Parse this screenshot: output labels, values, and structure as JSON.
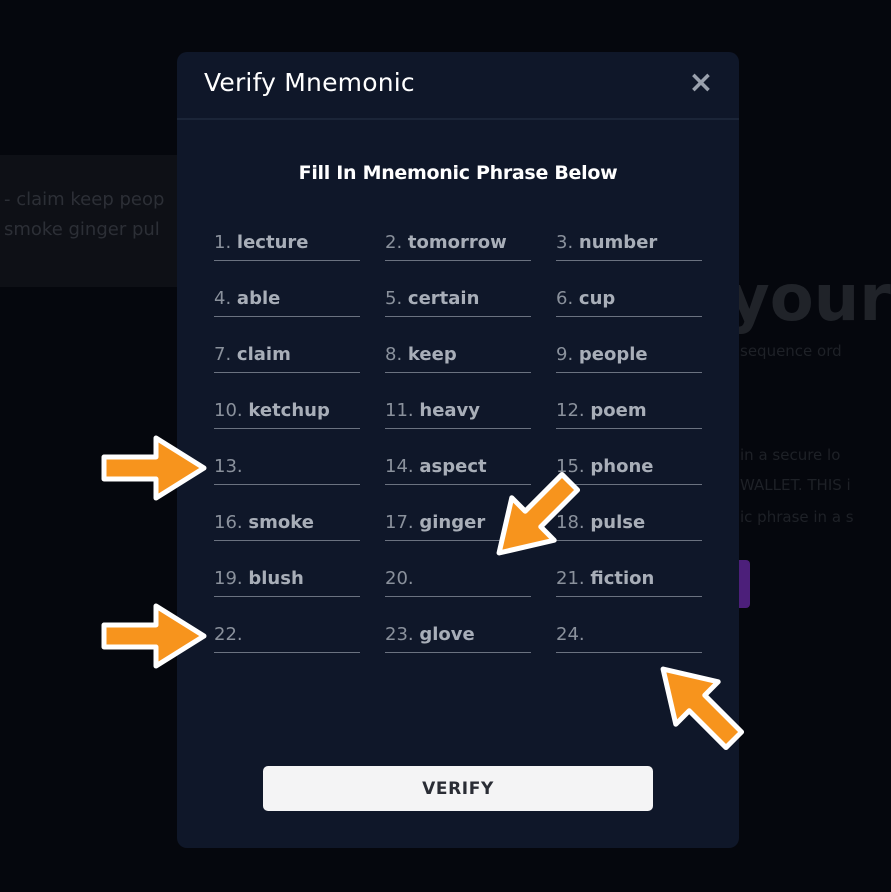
{
  "background": {
    "text_line_1": "- claim keep peop",
    "text_line_2": "smoke ginger pul",
    "heading": "your",
    "subtext_1": "sequence ord",
    "subtext_2": "in a secure lo",
    "subtext_3": "WALLET. THIS i",
    "subtext_4": "ic phrase in a s"
  },
  "modal": {
    "title": "Verify Mnemonic",
    "close_icon": "×",
    "subtitle": "Fill In Mnemonic Phrase Below",
    "words": [
      {
        "num": "1.",
        "word": "lecture"
      },
      {
        "num": "2.",
        "word": "tomorrow"
      },
      {
        "num": "3.",
        "word": "number"
      },
      {
        "num": "4.",
        "word": "able"
      },
      {
        "num": "5.",
        "word": "certain"
      },
      {
        "num": "6.",
        "word": "cup"
      },
      {
        "num": "7.",
        "word": "claim"
      },
      {
        "num": "8.",
        "word": "keep"
      },
      {
        "num": "9.",
        "word": "people"
      },
      {
        "num": "10.",
        "word": "ketchup"
      },
      {
        "num": "11.",
        "word": "heavy"
      },
      {
        "num": "12.",
        "word": "poem"
      },
      {
        "num": "13.",
        "word": ""
      },
      {
        "num": "14.",
        "word": "aspect"
      },
      {
        "num": "15.",
        "word": "phone"
      },
      {
        "num": "16.",
        "word": "smoke"
      },
      {
        "num": "17.",
        "word": "ginger"
      },
      {
        "num": "18.",
        "word": "pulse"
      },
      {
        "num": "19.",
        "word": "blush"
      },
      {
        "num": "20.",
        "word": ""
      },
      {
        "num": "21.",
        "word": "fiction"
      },
      {
        "num": "22.",
        "word": ""
      },
      {
        "num": "23.",
        "word": "glove"
      },
      {
        "num": "24.",
        "word": ""
      }
    ],
    "verify_label": "VERIFY"
  },
  "annotations": {
    "arrow_color": "#f7941d",
    "arrow_icon": "annotation-arrow-icon"
  }
}
